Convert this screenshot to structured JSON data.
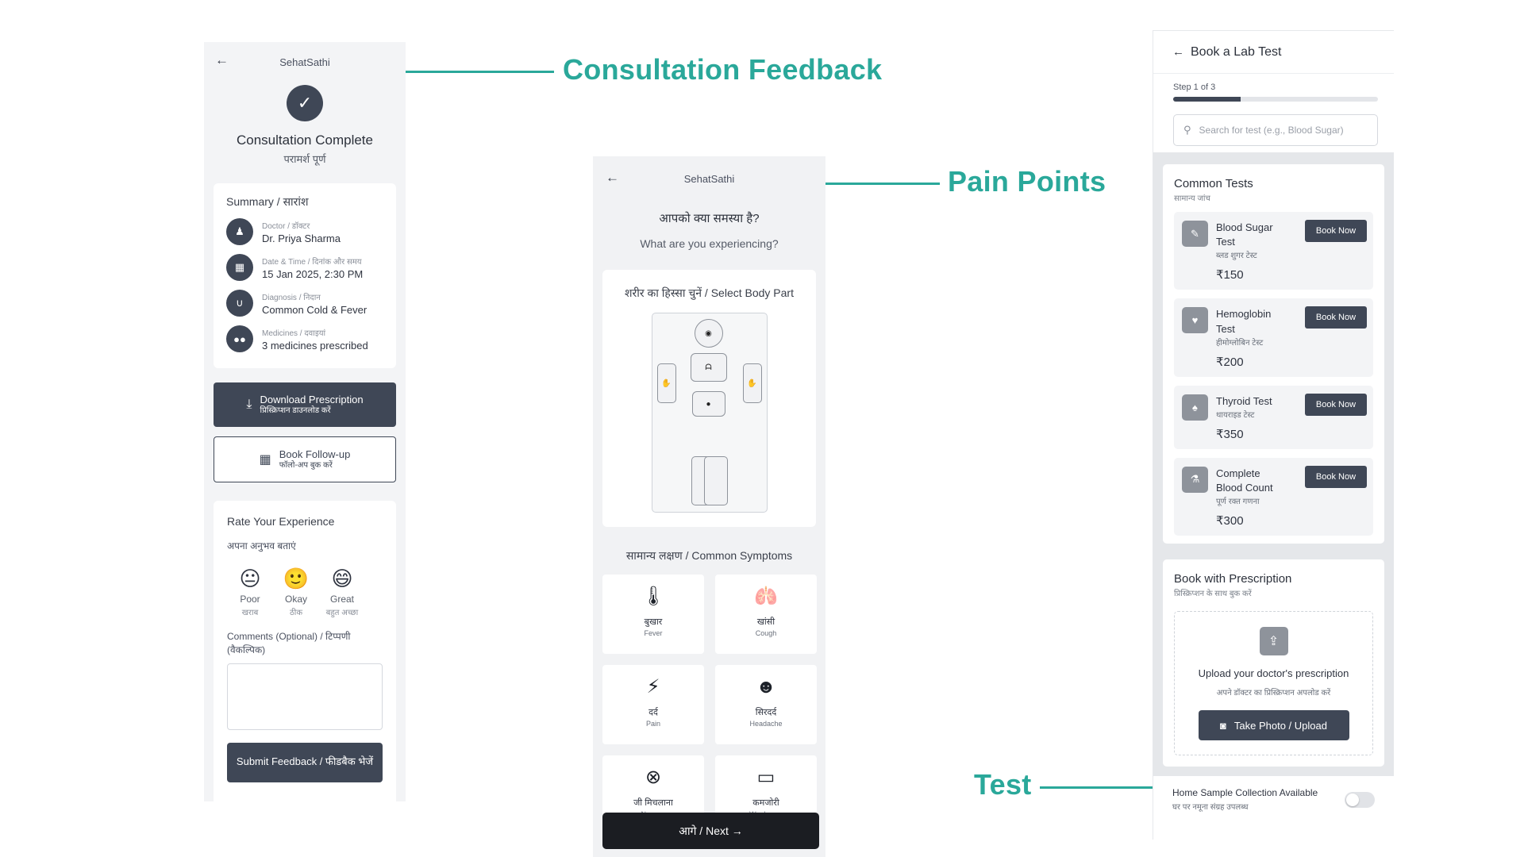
{
  "annotations": {
    "consultation": "Consultation Feedback",
    "pain": "Pain Points",
    "test": "Test"
  },
  "colors": {
    "annotation": "#2aa89a",
    "primary_dark": "#3f4756",
    "next_button": "#1b1d22"
  },
  "feedback_screen": {
    "app_title": "SehatSathi",
    "back_icon": "arrow-left-icon",
    "title": "Consultation Complete",
    "title_hi": "परामर्श पूर्ण",
    "summary": {
      "heading": "Summary / सारांश",
      "rows": [
        {
          "icon": "doctor-icon",
          "label": "Doctor / डॉक्टर",
          "value": "Dr. Priya Sharma"
        },
        {
          "icon": "calendar-icon",
          "label": "Date & Time / दिनांक और समय",
          "value": "15 Jan 2025, 2:30 PM"
        },
        {
          "icon": "stethoscope-icon",
          "label": "Diagnosis / निदान",
          "value": "Common Cold & Fever"
        },
        {
          "icon": "pills-icon",
          "label": "Medicines / दवाइयां",
          "value": "3 medicines prescribed"
        }
      ]
    },
    "download": {
      "label": "Download Prescription",
      "label_hi": "प्रिस्क्रिप्शन डाउनलोड करें"
    },
    "followup": {
      "label": "Book Follow-up",
      "label_hi": "फॉलो-अप बुक करें"
    },
    "rating": {
      "heading": "Rate Your Experience",
      "heading_hi": "अपना अनुभव बताएं",
      "options": [
        {
          "face": "😐",
          "label": "Poor",
          "label_hi": "खराब"
        },
        {
          "face": "🙂",
          "label": "Okay",
          "label_hi": "ठीक"
        },
        {
          "face": "😄",
          "label": "Great",
          "label_hi": "बहुत अच्छा"
        }
      ],
      "comments_label": "Comments (Optional) / टिप्पणी (वैकल्पिक)",
      "submit": "Submit Feedback / फीडबैक भेजें"
    }
  },
  "pain_screen": {
    "app_title": "SehatSathi",
    "question_hi": "आपको क्या समस्या है?",
    "question": "What are you experiencing?",
    "body_heading": "शरीर का हिस्सा चुनें / Select Body Part",
    "symptoms_heading": "सामान्य लक्षण / Common Symptoms",
    "symptoms": [
      {
        "icon": "thermometer-icon",
        "glyph": "🌡",
        "label": "बुखार",
        "sub": "Fever"
      },
      {
        "icon": "lungs-icon",
        "glyph": "🫁",
        "label": "खांसी",
        "sub": "Cough"
      },
      {
        "icon": "lightning-icon",
        "glyph": "⚡",
        "label": "दर्द",
        "sub": "Pain"
      },
      {
        "icon": "head-icon",
        "glyph": "☻",
        "label": "सिरदर्द",
        "sub": "Headache"
      },
      {
        "icon": "nausea-icon",
        "glyph": "⊗",
        "label": "जी मिचलाना",
        "sub": "Nausea"
      },
      {
        "icon": "battery-low-icon",
        "glyph": "▭",
        "label": "कमजोरी",
        "sub": "Weakness"
      }
    ],
    "next": "आगे / Next →"
  },
  "lab_screen": {
    "title": "Book a Lab Test",
    "step": "Step 1 of 3",
    "progress": 0.33,
    "search_placeholder": "Search for test (e.g., Blood Sugar)",
    "common": {
      "heading": "Common Tests",
      "heading_hi": "सामान्य जांच",
      "tests": [
        {
          "icon": "syringe-icon",
          "glyph": "✎",
          "name": "Blood Sugar Test",
          "name_hi": "ब्लड शुगर टेस्ट",
          "price": "₹150",
          "button": "Book Now"
        },
        {
          "icon": "heart-icon",
          "glyph": "♥",
          "name": "Hemoglobin Test",
          "name_hi": "हीमोग्लोबिन टेस्ट",
          "price": "₹200",
          "button": "Book Now"
        },
        {
          "icon": "lungs-icon",
          "glyph": "♠",
          "name": "Thyroid Test",
          "name_hi": "थायराइड टेस्ट",
          "price": "₹350",
          "button": "Book Now"
        },
        {
          "icon": "flask-icon",
          "glyph": "⚗",
          "name": "Complete Blood Count",
          "name_hi": "पूर्ण रक्त गणना",
          "price": "₹300",
          "button": "Book Now"
        }
      ]
    },
    "prescription": {
      "heading": "Book with Prescription",
      "heading_hi": "प्रिस्क्रिप्शन के साथ बुक करें",
      "upload_title": "Upload your doctor's prescription",
      "upload_hi": "अपने डॉक्टर का प्रिस्क्रिप्शन अपलोड करें",
      "button": "Take Photo / Upload"
    },
    "home": {
      "label": "Home Sample Collection Available",
      "label_hi": "घर पर नमूना संग्रह उपलब्ध",
      "enabled": false
    }
  }
}
